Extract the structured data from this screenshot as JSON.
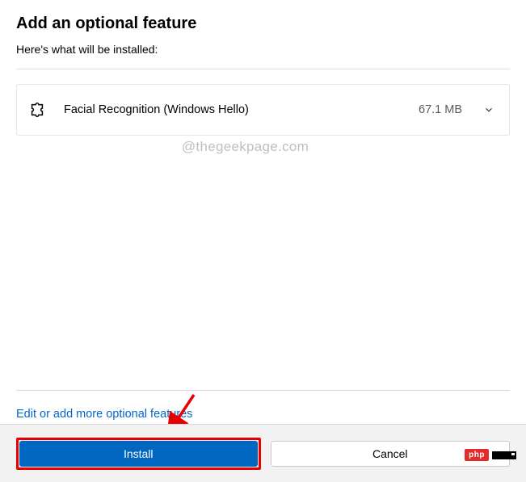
{
  "header": {
    "title": "Add an optional feature",
    "subtitle": "Here's what will be installed:"
  },
  "features": [
    {
      "name": "Facial Recognition (Windows Hello)",
      "size": "67.1 MB"
    }
  ],
  "watermark": "@thegeekpage.com",
  "link_text": "Edit or add more optional features",
  "buttons": {
    "install": "Install",
    "cancel": "Cancel"
  },
  "badge": "php"
}
